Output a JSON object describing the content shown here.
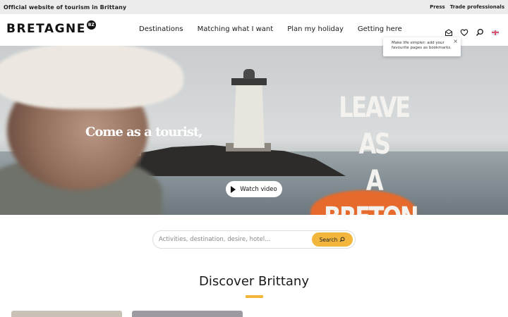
{
  "topbar": {
    "official": "Official website of tourism in Brittany",
    "press": "Press",
    "trade": "Trade professionals"
  },
  "logo": {
    "word": "BRETAGNE",
    "badge": "BZ"
  },
  "nav": {
    "items": [
      "Destinations",
      "Matching what I want",
      "Plan my holiday",
      "Getting here"
    ]
  },
  "header_icons": [
    "newsletter-icon",
    "heart-icon",
    "search-icon",
    "flag-uk-icon"
  ],
  "tooltip": {
    "text": "Make life simpler: add your favourite pages as bookmarks.",
    "close": "×"
  },
  "hero": {
    "slogan_left": "Come as a tourist,",
    "slogan_right_line1": "LEAVE AS",
    "slogan_right_line2": "A BRETON.",
    "watch_label": "Watch video"
  },
  "search": {
    "placeholder": "Activities, destination, desire, hotel...",
    "button_label": "Search"
  },
  "discover": {
    "title": "Discover Brittany"
  },
  "colors": {
    "accent": "#f2b63d",
    "topbar_bg": "#ececec"
  }
}
